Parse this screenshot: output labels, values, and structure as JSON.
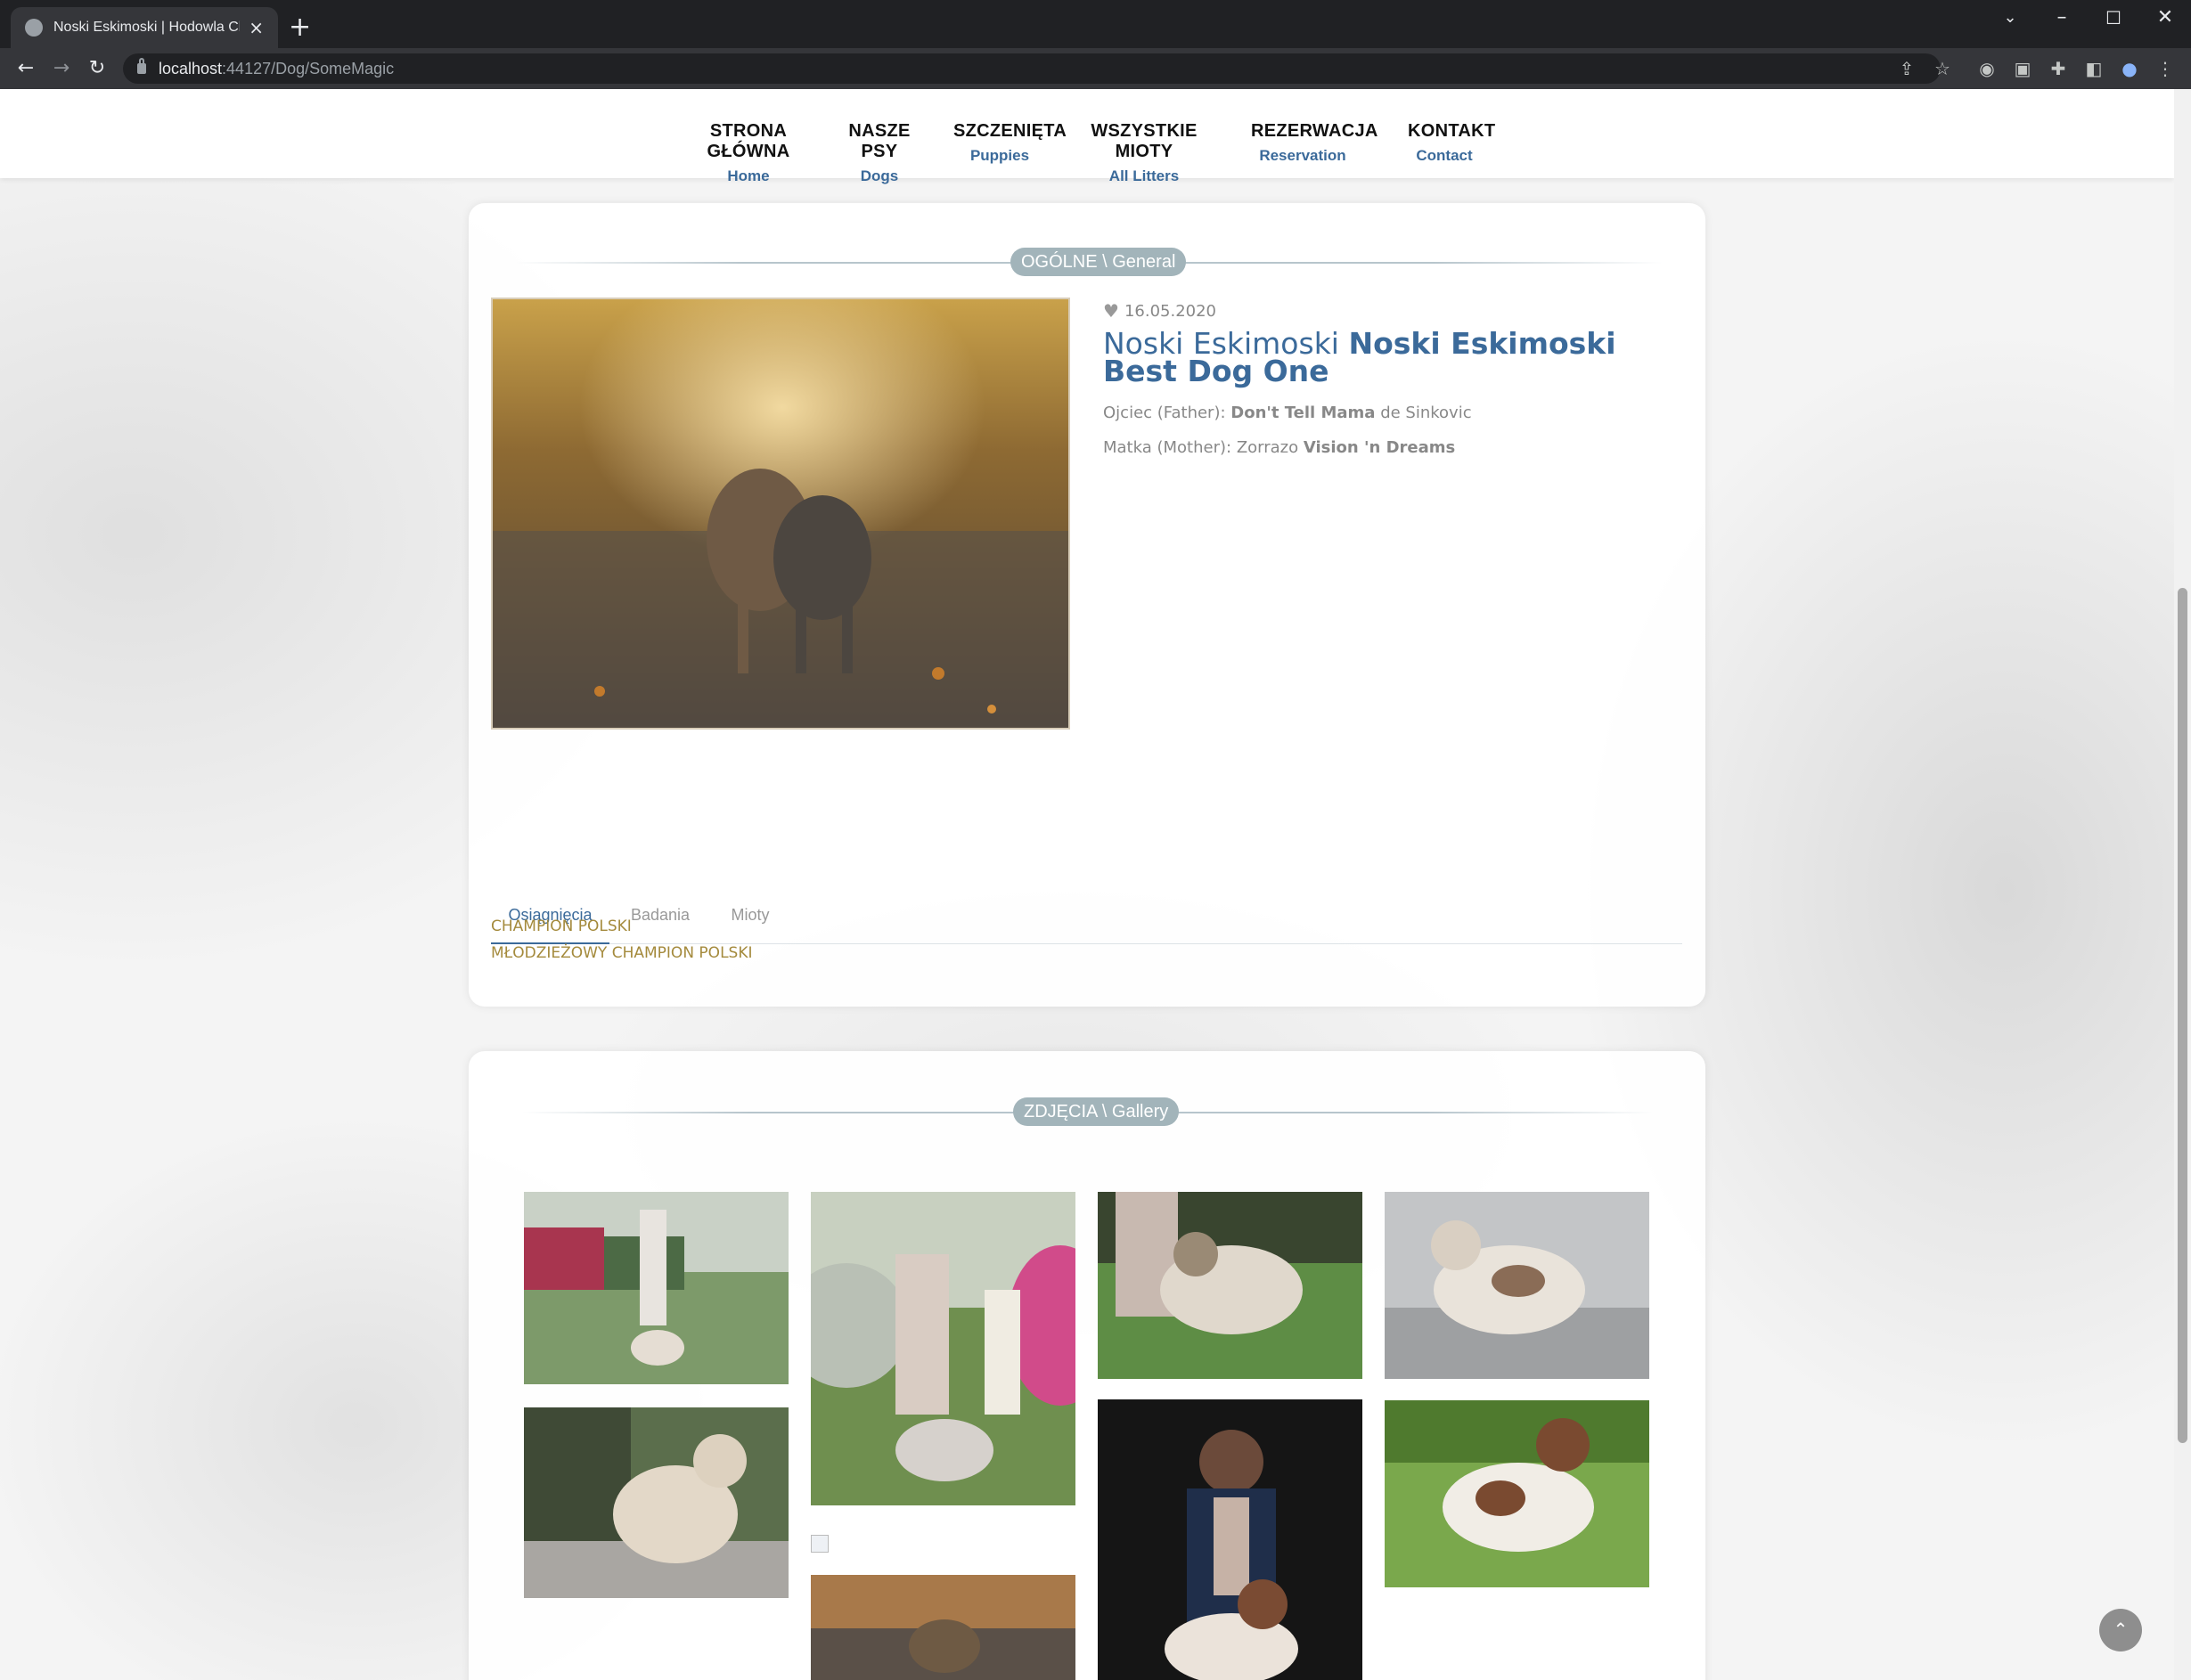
{
  "browser": {
    "tab_title": "Noski Eskimoski | Hodowla Charc",
    "url_host": "localhost",
    "url_path": ":44127/Dog/SomeMagic"
  },
  "nav": [
    {
      "pl": "STRONA GŁÓWNA",
      "en": "Home"
    },
    {
      "pl": "NASZE PSY",
      "en": "Dogs"
    },
    {
      "pl": "SZCZENIĘTA",
      "en": "Puppies"
    },
    {
      "pl": "WSZYSTKIE MIOTY",
      "en": "All Litters"
    },
    {
      "pl": "REZERWACJA",
      "en": "Reservation"
    },
    {
      "pl": "KONTAKT",
      "en": "Contact"
    }
  ],
  "general": {
    "section_label": "OGÓLNE \\ General",
    "date": "16.05.2020",
    "name_prefix": "Noski Eskimoski",
    "name_main": "Noski Eskimoski Best Dog One",
    "father_label": "Ojciec (Father):",
    "father_name_bold": "Don't Tell Mama",
    "father_name_rest": "de Sinkovic",
    "mother_label": "Matka (Mother):",
    "mother_name_rest": "Zorrazo",
    "mother_name_bold": "Vision 'n Dreams"
  },
  "tabs": [
    {
      "label": "Osiągnięcia",
      "active": true
    },
    {
      "label": "Badania",
      "active": false
    },
    {
      "label": "Mioty",
      "active": false
    }
  ],
  "achievements": [
    "CHAMPION POLSKI",
    "MŁODZIEŻOWY CHAMPION POLSKI"
  ],
  "gallery": {
    "section_label": "ZDJĘCIA \\ Gallery"
  },
  "icons": {
    "heart": "heart-icon",
    "scroll_top": "chevron-up-icon"
  },
  "colors": {
    "accent_blue": "#3b6a9a",
    "achievement_gold": "#a48a3c",
    "pill_grey": "#a2b4ba"
  }
}
